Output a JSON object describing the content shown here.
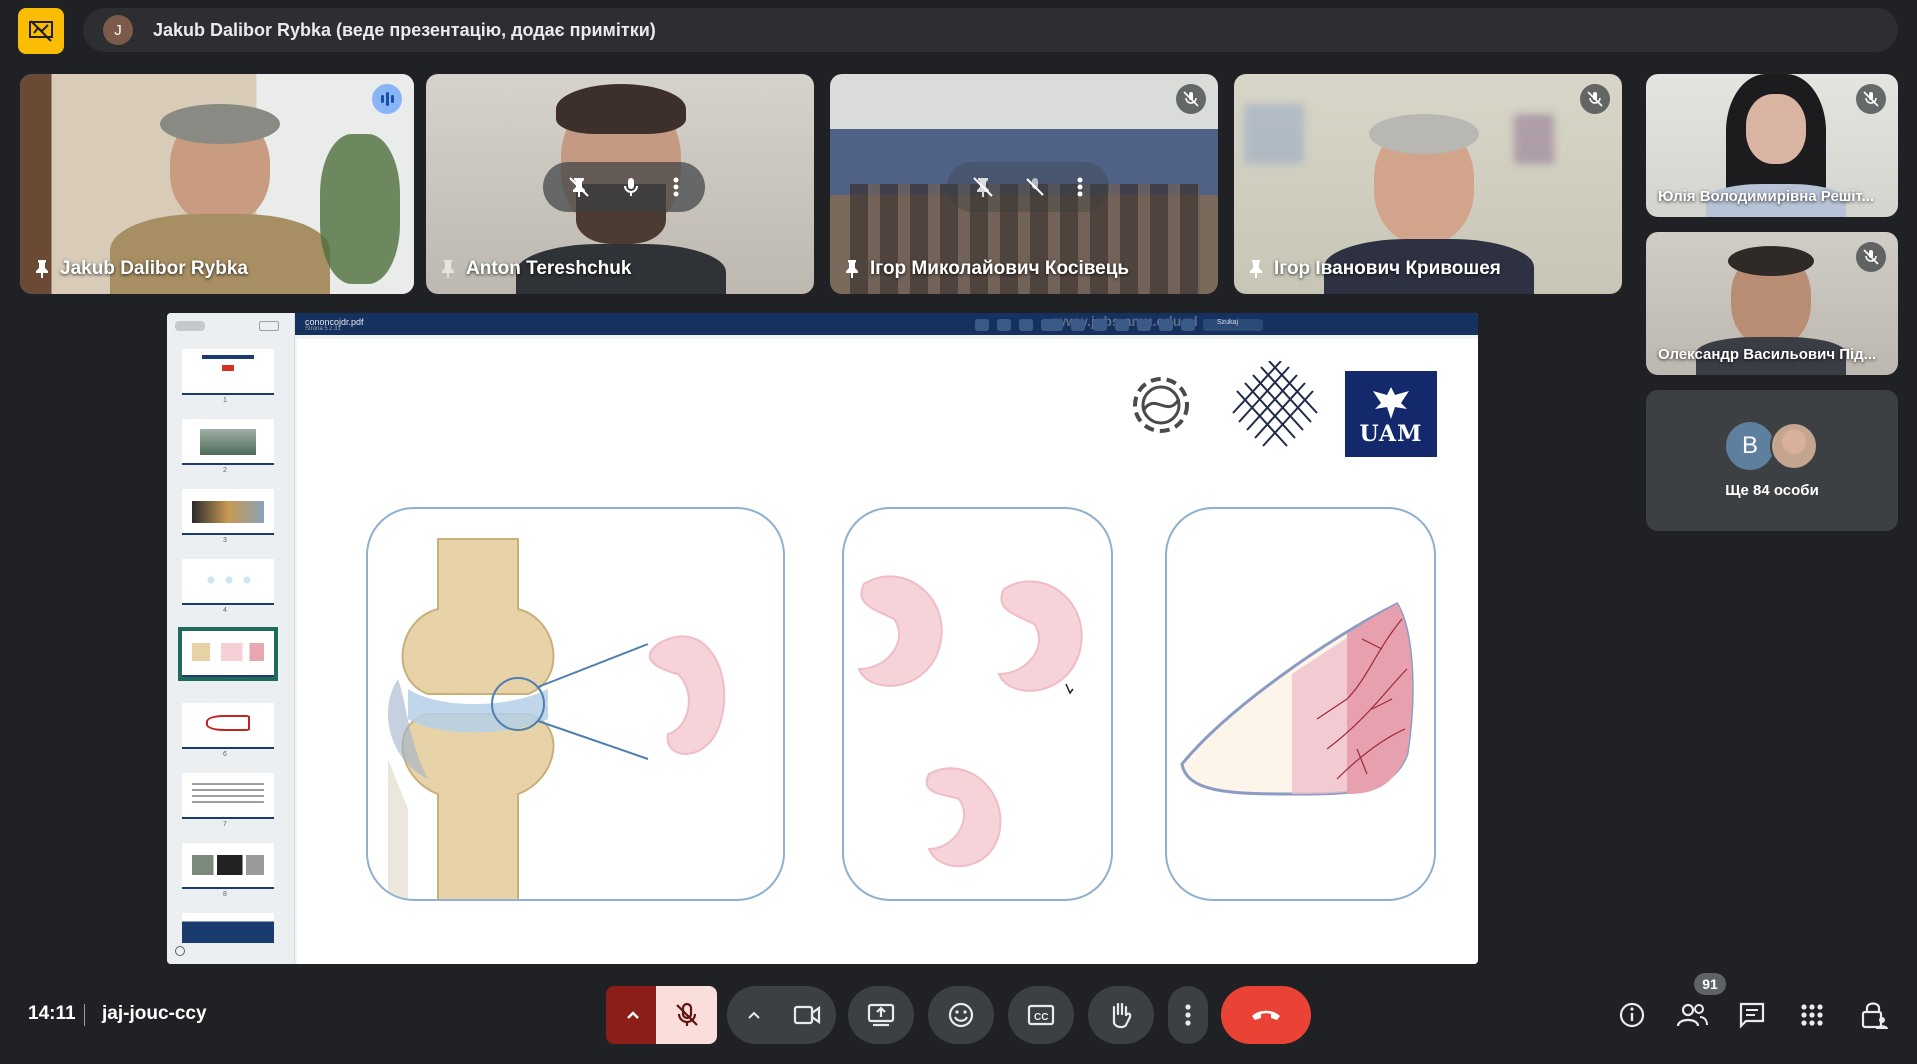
{
  "presenting_bar": {
    "avatar_letter": "J",
    "text": "Jakub Dalibor Rybka (веде презентацію, додає примітки)"
  },
  "tiles": [
    {
      "name": "Jakub Dalibor Rybka",
      "status": "speaking"
    },
    {
      "name": "Anton Tereshchuk",
      "status": "hover-controls"
    },
    {
      "name": "Ігор Миколайович Косівець",
      "status": "muted"
    },
    {
      "name": "Ігор Іванович Кривошея",
      "status": "muted"
    }
  ],
  "side_tiles": [
    {
      "name": "Юлія Володимирівна Решіт...",
      "status": "muted"
    },
    {
      "name": "Олександр Васильович Під...",
      "status": "muted"
    }
  ],
  "others": {
    "avatar_letter": "B",
    "label": "Ще 84 особи"
  },
  "shared_screen": {
    "file_name": "cononcojdr.pdf",
    "page_info": "Strona 5 z 31",
    "search_placeholder": "Szukaj",
    "watermark": "www.jgbs.amu.edu.pl",
    "thumb_numbers": [
      "1",
      "2",
      "3",
      "4",
      "5",
      "6",
      "7",
      "8"
    ],
    "active_thumb": "5",
    "logos": [
      "gear-molecule-logo",
      "mesh-logo",
      "UAM"
    ],
    "logo_text": "UAM"
  },
  "bottom_bar": {
    "time": "14:11",
    "meeting_code": "jaj-jouc-ccy",
    "participant_count": "91"
  },
  "colors": {
    "background": "#202124",
    "control": "#3c4043",
    "mic_off": "#f28b82",
    "end_call": "#ea4335",
    "presenting": "#fbbc04",
    "uam_blue": "#13296b"
  }
}
